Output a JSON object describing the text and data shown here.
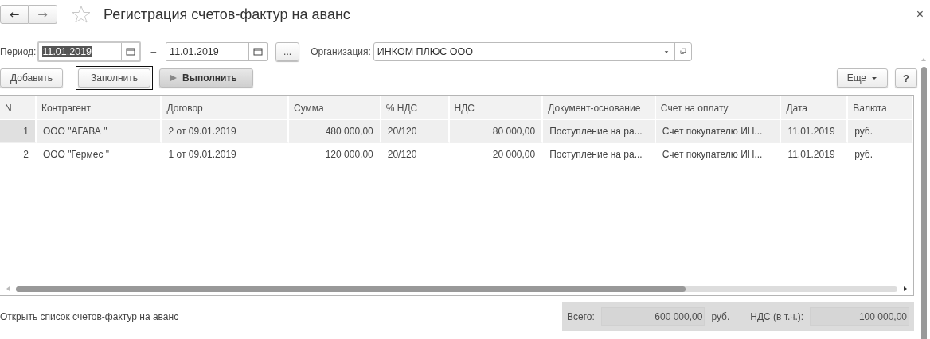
{
  "window": {
    "title": "Регистрация счетов-фактур на аванс",
    "close": "×"
  },
  "nav": {
    "back": "←",
    "forward": "→"
  },
  "period": {
    "label": "Период:",
    "from": "11.01.2019",
    "dash": "–",
    "to": "11.01.2019",
    "more": "..."
  },
  "organization": {
    "label": "Организация:",
    "value": "ИНКОМ ПЛЮС ООО"
  },
  "toolbar": {
    "add": "Добавить",
    "fill": "Заполнить",
    "run": "Выполнить",
    "more": "Еще",
    "help": "?"
  },
  "table": {
    "columns": [
      {
        "label": "N",
        "kind": "number"
      },
      {
        "label": "Контрагент",
        "kind": "text"
      },
      {
        "label": "Договор",
        "kind": "text"
      },
      {
        "label": "Сумма",
        "kind": "number"
      },
      {
        "label": "% НДС",
        "kind": "text"
      },
      {
        "label": "НДС",
        "kind": "number"
      },
      {
        "label": "Документ-основание",
        "kind": "text"
      },
      {
        "label": "Счет на оплату",
        "kind": "text"
      },
      {
        "label": "Дата",
        "kind": "text"
      },
      {
        "label": "Валюта",
        "kind": "text"
      }
    ],
    "rows": [
      {
        "selected": true,
        "cells": [
          "1",
          "ООО \"АГАВА \"",
          "2 от 09.01.2019",
          "480 000,00",
          "20/120",
          "80 000,00",
          "Поступление на ра...",
          "Счет покупателю ИН...",
          "11.01.2019",
          "руб."
        ]
      },
      {
        "selected": false,
        "cells": [
          "2",
          "ООО \"Гермес \"",
          "1 от 09.01.2019",
          "120 000,00",
          "20/120",
          "20 000,00",
          "Поступление на ра...",
          "Счет покупателю ИН...",
          "11.01.2019",
          "руб."
        ]
      }
    ]
  },
  "link": "Открыть список счетов-фактур на аванс",
  "totals": {
    "total_label": "Всего:",
    "total": "600 000,00",
    "currency": "руб.",
    "vat_label": "НДС (в т.ч.):",
    "vat": "100 000,00"
  }
}
